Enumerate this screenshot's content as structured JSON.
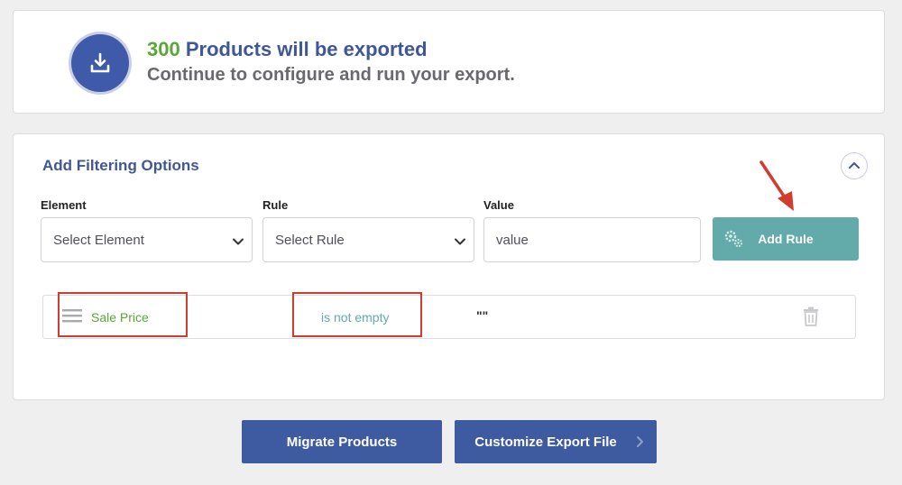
{
  "summary": {
    "count": "300",
    "headline_rest": " Products will be exported",
    "subline": "Continue to configure and run your export."
  },
  "filter": {
    "title": "Add Filtering Options",
    "element_label": "Element",
    "rule_label": "Rule",
    "value_label": "Value",
    "element_select": "Select Element",
    "rule_select": "Select Rule",
    "value_placeholder": "value",
    "add_rule_label": "Add Rule",
    "rules": [
      {
        "element": "Sale Price",
        "rule": "is not empty",
        "value": "\"\""
      }
    ]
  },
  "actions": {
    "migrate_label": "Migrate Products",
    "customize_label": "Customize Export File"
  },
  "colors": {
    "brand_blue": "#3e5aa0",
    "teal": "#62abaa",
    "green": "#5aa637",
    "annotation_red": "#d33b2c"
  },
  "icons": [
    "export-download-icon",
    "chevron-up-icon",
    "chevron-down-icon",
    "gear-icon",
    "drag-handle-icon",
    "trash-icon",
    "chevron-right-icon",
    "annotation-arrow-icon"
  ]
}
